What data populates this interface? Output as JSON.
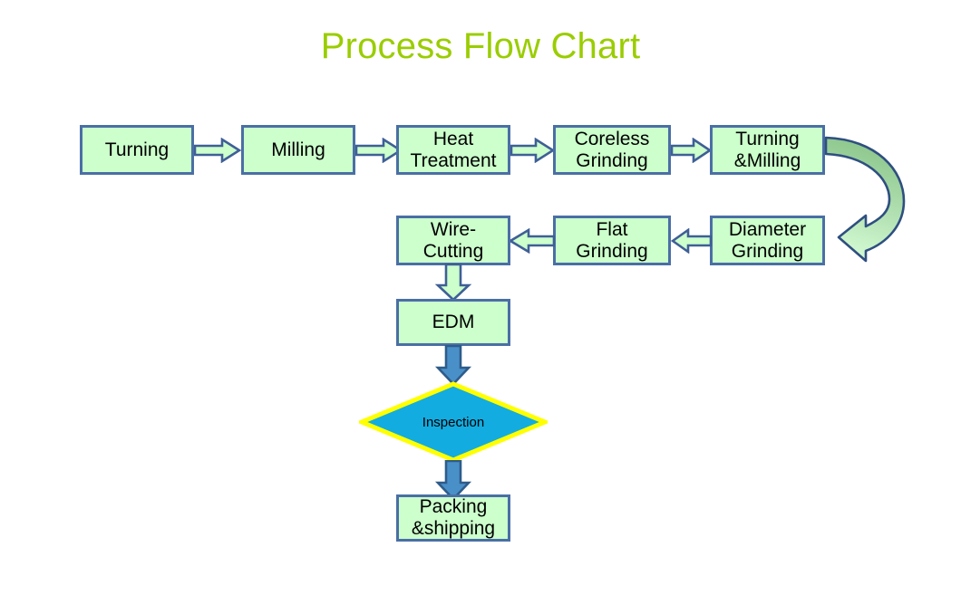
{
  "title": "Process Flow Chart",
  "colors": {
    "title": "#9ACD00",
    "node_fill": "#CCFFCC",
    "node_border": "#4A6FA5",
    "arrow_fill": "#CCFFCC",
    "arrow_border": "#3F5F96",
    "blue_arrow_fill": "#4A90C8",
    "blue_arrow_border": "#2E5C8A",
    "decision_fill": "#13ACE0",
    "decision_border": "#FFFF00",
    "curve_fill_start": "#8FC98F",
    "curve_fill_end": "#D6FFD6",
    "background": "#FFFFFF"
  },
  "chart_data": {
    "type": "diagram",
    "title": "Process Flow Chart",
    "nodes": [
      {
        "id": "turning",
        "label": "Turning",
        "shape": "process",
        "row": 1,
        "order": 1
      },
      {
        "id": "milling",
        "label": "Milling",
        "shape": "process",
        "row": 1,
        "order": 2
      },
      {
        "id": "heat",
        "label": "Heat\nTreatment",
        "shape": "process",
        "row": 1,
        "order": 3
      },
      {
        "id": "coreless",
        "label": "Coreless\nGrinding",
        "shape": "process",
        "row": 1,
        "order": 4
      },
      {
        "id": "turnmill",
        "label": "Turning\n&Milling",
        "shape": "process",
        "row": 1,
        "order": 5
      },
      {
        "id": "diameter",
        "label": "Diameter\nGrinding",
        "shape": "process",
        "row": 2,
        "order": 1
      },
      {
        "id": "flat",
        "label": "Flat\nGrinding",
        "shape": "process",
        "row": 2,
        "order": 2
      },
      {
        "id": "wire",
        "label": "Wire-\nCutting",
        "shape": "process",
        "row": 2,
        "order": 3
      },
      {
        "id": "edm",
        "label": "EDM",
        "shape": "process",
        "row": 3,
        "order": 1
      },
      {
        "id": "inspection",
        "label": "Inspection",
        "shape": "decision",
        "row": 4,
        "order": 1
      },
      {
        "id": "packing",
        "label": "Packing\n&shipping",
        "shape": "process",
        "row": 5,
        "order": 1
      }
    ],
    "edges": [
      {
        "from": "turning",
        "to": "milling",
        "direction": "right",
        "style": "block-arrow-green"
      },
      {
        "from": "milling",
        "to": "heat",
        "direction": "right",
        "style": "block-arrow-green"
      },
      {
        "from": "heat",
        "to": "coreless",
        "direction": "right",
        "style": "block-arrow-green"
      },
      {
        "from": "coreless",
        "to": "turnmill",
        "direction": "right",
        "style": "block-arrow-green"
      },
      {
        "from": "turnmill",
        "to": "diameter",
        "direction": "curve-down",
        "style": "curved-arrow-green"
      },
      {
        "from": "diameter",
        "to": "flat",
        "direction": "left",
        "style": "block-arrow-green"
      },
      {
        "from": "flat",
        "to": "wire",
        "direction": "left",
        "style": "block-arrow-green"
      },
      {
        "from": "wire",
        "to": "edm",
        "direction": "down",
        "style": "block-arrow-green"
      },
      {
        "from": "edm",
        "to": "inspection",
        "direction": "down",
        "style": "block-arrow-blue"
      },
      {
        "from": "inspection",
        "to": "packing",
        "direction": "down",
        "style": "block-arrow-blue"
      }
    ]
  }
}
